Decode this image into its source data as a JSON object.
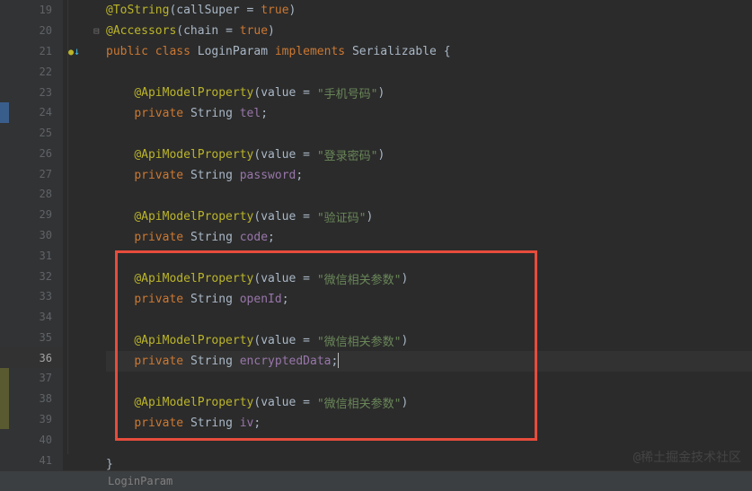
{
  "lines": [
    {
      "n": 19,
      "indent": 1,
      "tokens": [
        [
          "ann",
          "@ToString"
        ],
        [
          "pun",
          "("
        ],
        [
          "cls",
          "callSuper"
        ],
        [
          "pun",
          " = "
        ],
        [
          "kw",
          "true"
        ],
        [
          "pun",
          ")"
        ]
      ]
    },
    {
      "n": 20,
      "indent": 1,
      "tokens": [
        [
          "ann",
          "@Accessors"
        ],
        [
          "pun",
          "("
        ],
        [
          "cls",
          "chain"
        ],
        [
          "pun",
          " = "
        ],
        [
          "kw",
          "true"
        ],
        [
          "pun",
          ")"
        ]
      ]
    },
    {
      "n": 21,
      "indent": 1,
      "tokens": [
        [
          "kw",
          "public class "
        ],
        [
          "cls",
          "LoginParam "
        ],
        [
          "kw",
          "implements "
        ],
        [
          "cls",
          "Serializable "
        ],
        [
          "pun",
          "{"
        ]
      ]
    },
    {
      "n": 22,
      "indent": 1,
      "tokens": []
    },
    {
      "n": 23,
      "indent": 2,
      "tokens": [
        [
          "ann",
          "@ApiModelProperty"
        ],
        [
          "pun",
          "("
        ],
        [
          "cls",
          "value"
        ],
        [
          "pun",
          " = "
        ],
        [
          "str",
          "\"手机号码\""
        ],
        [
          "pun",
          ")"
        ]
      ]
    },
    {
      "n": 24,
      "indent": 2,
      "hl": true,
      "tokens": [
        [
          "kw",
          "private "
        ],
        [
          "cls",
          "String "
        ],
        [
          "fld",
          "tel"
        ],
        [
          "pun",
          ";"
        ]
      ]
    },
    {
      "n": 25,
      "indent": 1,
      "tokens": []
    },
    {
      "n": 26,
      "indent": 2,
      "tokens": [
        [
          "ann",
          "@ApiModelProperty"
        ],
        [
          "pun",
          "("
        ],
        [
          "cls",
          "value"
        ],
        [
          "pun",
          " = "
        ],
        [
          "str",
          "\"登录密码\""
        ],
        [
          "pun",
          ")"
        ]
      ]
    },
    {
      "n": 27,
      "indent": 2,
      "tokens": [
        [
          "kw",
          "private "
        ],
        [
          "cls",
          "String "
        ],
        [
          "fld",
          "password"
        ],
        [
          "pun",
          ";"
        ]
      ]
    },
    {
      "n": 28,
      "indent": 1,
      "tokens": []
    },
    {
      "n": 29,
      "indent": 2,
      "tokens": [
        [
          "ann",
          "@ApiModelProperty"
        ],
        [
          "pun",
          "("
        ],
        [
          "cls",
          "value"
        ],
        [
          "pun",
          " = "
        ],
        [
          "str",
          "\"验证码\""
        ],
        [
          "pun",
          ")"
        ]
      ]
    },
    {
      "n": 30,
      "indent": 2,
      "tokens": [
        [
          "kw",
          "private "
        ],
        [
          "cls",
          "String "
        ],
        [
          "fld",
          "code"
        ],
        [
          "pun",
          ";"
        ]
      ]
    },
    {
      "n": 31,
      "indent": 1,
      "tokens": []
    },
    {
      "n": 32,
      "indent": 2,
      "tokens": [
        [
          "ann",
          "@ApiModelProperty"
        ],
        [
          "pun",
          "("
        ],
        [
          "cls",
          "value"
        ],
        [
          "pun",
          " = "
        ],
        [
          "str",
          "\"微信相关参数\""
        ],
        [
          "pun",
          ")"
        ]
      ]
    },
    {
      "n": 33,
      "indent": 2,
      "tokens": [
        [
          "kw",
          "private "
        ],
        [
          "cls",
          "String "
        ],
        [
          "fld",
          "openId"
        ],
        [
          "pun",
          ";"
        ]
      ]
    },
    {
      "n": 34,
      "indent": 1,
      "tokens": []
    },
    {
      "n": 35,
      "indent": 2,
      "tokens": [
        [
          "ann",
          "@ApiModelProperty"
        ],
        [
          "pun",
          "("
        ],
        [
          "cls",
          "value"
        ],
        [
          "pun",
          " = "
        ],
        [
          "str",
          "\"微信相关参数\""
        ],
        [
          "pun",
          ")"
        ]
      ]
    },
    {
      "n": 36,
      "indent": 2,
      "current": true,
      "tokens": [
        [
          "kw",
          "private "
        ],
        [
          "cls",
          "String "
        ],
        [
          "fld",
          "encryptedData"
        ],
        [
          "pun",
          ";"
        ]
      ],
      "cursor": true
    },
    {
      "n": 37,
      "indent": 1,
      "tokens": []
    },
    {
      "n": 38,
      "indent": 2,
      "tokens": [
        [
          "ann",
          "@ApiModelProperty"
        ],
        [
          "pun",
          "("
        ],
        [
          "cls",
          "value"
        ],
        [
          "pun",
          " = "
        ],
        [
          "str",
          "\"微信相关参数\""
        ],
        [
          "pun",
          ")"
        ]
      ]
    },
    {
      "n": 39,
      "indent": 2,
      "tokens": [
        [
          "kw",
          "private "
        ],
        [
          "cls",
          "String "
        ],
        [
          "fld",
          "iv"
        ],
        [
          "pun",
          ";"
        ]
      ]
    },
    {
      "n": 40,
      "indent": 1,
      "tokens": []
    },
    {
      "n": 41,
      "indent": 1,
      "tokens": [
        [
          "pun",
          "}"
        ]
      ]
    }
  ],
  "breadcrumb": "LoginParam",
  "watermark": "@稀土掘金技术社区",
  "left_highlights": {
    "24": "blue",
    "37": "yellow",
    "38": "yellow",
    "39": "yellow"
  }
}
